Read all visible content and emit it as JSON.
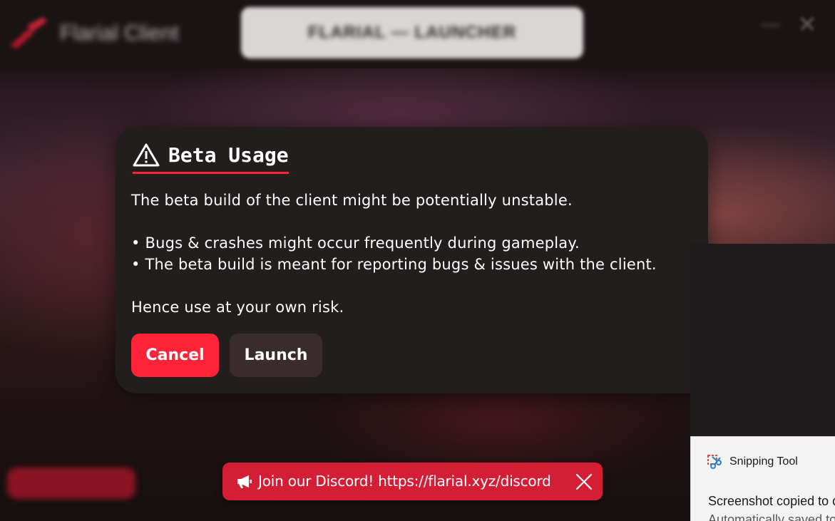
{
  "app": {
    "brand_name": "Flarial Client",
    "top_banner": "FLARIAL — LAUNCHER"
  },
  "colors": {
    "accent": "#ff2338",
    "modal_bg": "#231e1e",
    "secondary_button": "#3a2c2d",
    "discord_banner": "#d41e35"
  },
  "dialog": {
    "icon": "warning-icon",
    "title": "Beta Usage",
    "line1": "The beta build of the client might be potentially unstable.",
    "bullet1": "• Bugs & crashes might occur frequently during gameplay.",
    "bullet2": "• The beta build is meant for reporting bugs & issues with the client.",
    "line2": "Hence use at your own risk.",
    "cancel_label": "Cancel",
    "launch_label": "Launch"
  },
  "discord_banner": {
    "icon": "megaphone-icon",
    "text": "Join our Discord! https://flarial.xyz/discord",
    "close_icon": "close-icon"
  },
  "toast": {
    "app_name": "Snipping Tool",
    "title": "Screenshot copied to clipboard",
    "subtitle": "Automatically saved to screenshots folder"
  }
}
